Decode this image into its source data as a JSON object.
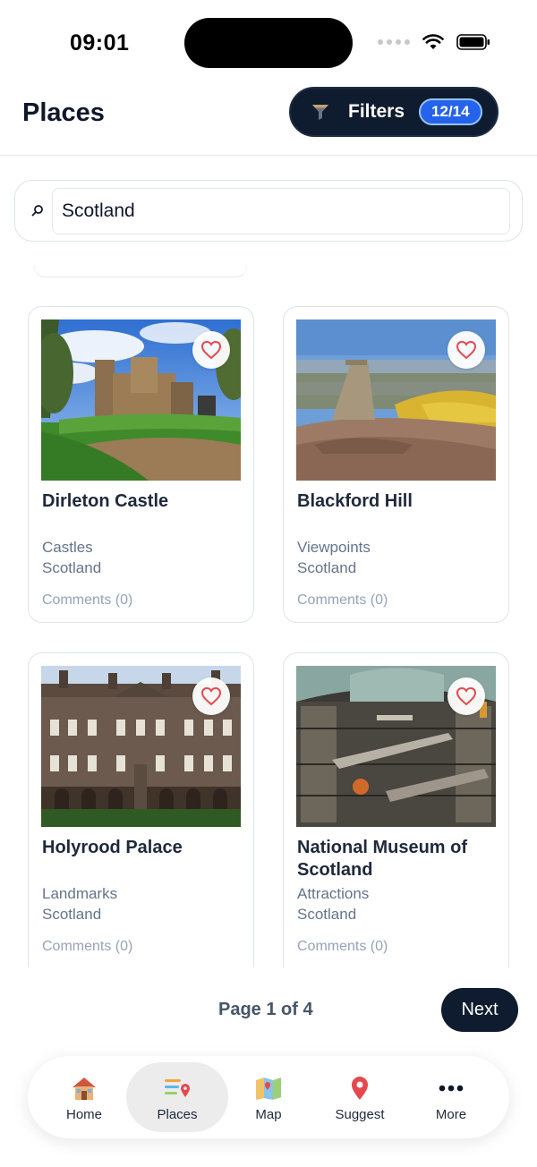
{
  "status_bar": {
    "time": "09:01"
  },
  "header": {
    "title": "Places",
    "filters_label": "Filters",
    "filters_count": "12/14"
  },
  "search": {
    "value": "Scotland"
  },
  "places": [
    {
      "name": "Dirleton Castle",
      "category": "Castles",
      "region": "Scotland",
      "comments": "Comments (0)"
    },
    {
      "name": "Blackford Hill",
      "category": "Viewpoints",
      "region": "Scotland",
      "comments": "Comments (0)"
    },
    {
      "name": "Holyrood Palace",
      "category": "Landmarks",
      "region": "Scotland",
      "comments": "Comments (0)"
    },
    {
      "name": "National Museum of Scotland",
      "category": "Attractions",
      "region": "Scotland",
      "comments": "Comments (0)"
    }
  ],
  "pagination": {
    "indicator": "Page 1 of 4",
    "next_label": "Next"
  },
  "tab_bar": {
    "items": [
      {
        "label": "Home",
        "icon": "house-icon"
      },
      {
        "label": "Places",
        "icon": "places-list-icon",
        "active": true
      },
      {
        "label": "Map",
        "icon": "map-icon"
      },
      {
        "label": "Suggest",
        "icon": "pin-icon"
      },
      {
        "label": "More",
        "icon": "more-dots-icon"
      }
    ]
  },
  "colors": {
    "primary_dark": "#0f1b2e",
    "badge_blue": "#2563eb",
    "heart_red": "#e5484d"
  }
}
